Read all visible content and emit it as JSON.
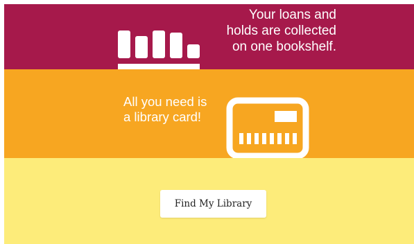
{
  "promo": {
    "loans_text": "Your loans and\nholds are collected\non one bookshelf.",
    "card_text": "All you need is\na library card!",
    "icons": {
      "bookshelf": "bookshelf-icon",
      "library_card": "library-card-icon"
    }
  },
  "cta": {
    "label": "Find My Library"
  },
  "colors": {
    "top_band": "#a6194b",
    "middle_band": "#f7a621",
    "bottom_band": "#fdec7a",
    "text": "#ffffff",
    "button_bg": "#ffffff"
  }
}
